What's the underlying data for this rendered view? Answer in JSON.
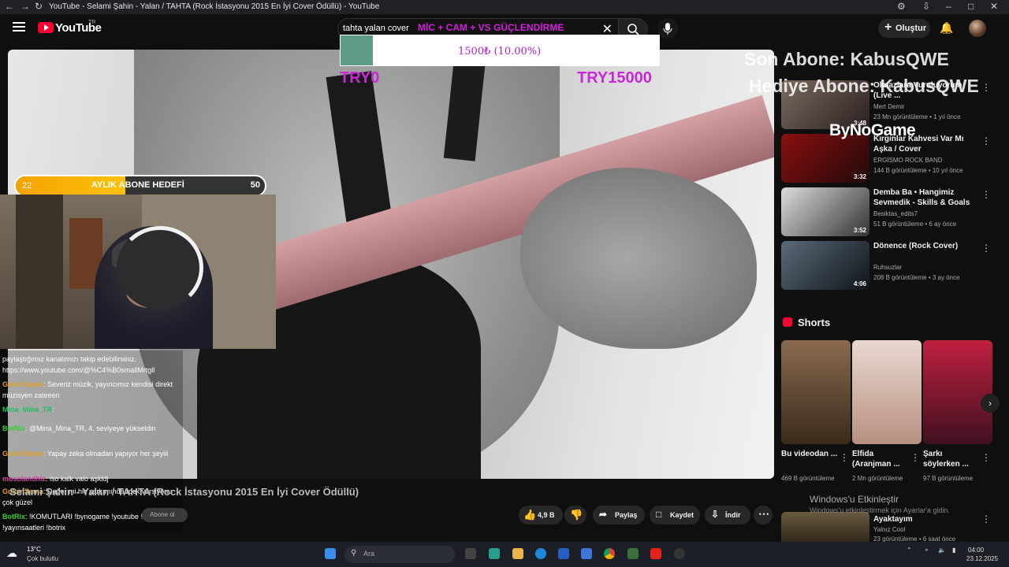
{
  "browser": {
    "tab_title": "YouTube - Selami Şahin - Yalan / TAHTA (Rock İstasyonu 2015 En İyi Cover Ödüllü) - YouTube"
  },
  "header": {
    "logo_text": "YouTube",
    "logo_region": "TR",
    "search_value": "tahta yalan cover",
    "create_label": "Oluştur"
  },
  "overlays": {
    "mic_banner": "MİC + CAM + VS GÜÇLENDİRME",
    "donation_text": "1500₺ (10.00%)",
    "donation_min": "TRY0",
    "donation_max": "TRY15000",
    "goal_current": "22",
    "goal_label": "AYLIK ABONE HEDEFİ",
    "goal_target": "50",
    "goal_progress": 0.44,
    "sub_line1": "Son Abone: KabusQWE",
    "sub_line2": "Hediye Abone: KabusQWE",
    "sponsor": "ByNoGame"
  },
  "chat": [
    {
      "name": "",
      "text": "paylaştığımız kanalımızı takip edebilirsiniz. https://www.youtube.com/@%C4%B0smallMrtgll",
      "color": "#ffffff"
    },
    {
      "name": "GulcinSama",
      "text": ": Severiz müzik, yayıncımız kendisi direkt müzisyen zateeen",
      "color": "#e0a020"
    },
    {
      "name": "Mina_Mina_TR",
      "text": ":",
      "color": "#20c060"
    },
    {
      "name": "BotRix",
      "text": ": @Mina_Mina_TR, 4. seviyeye yükseldin",
      "color": "#30d030"
    },
    {
      "name": "GulcinSama",
      "text": ": Yapay zeka olmadan yapıyor her şeyiii",
      "color": "#e0a020"
    },
    {
      "name": "mosolandhiz",
      "text": ": iso kalk valo aşkldj",
      "color": "#d040a0"
    },
    {
      "name": "GulcinSama",
      "text": ": Değer mi hiç şarkımında rock versiyonu çok güzel",
      "color": "#e0a020"
    },
    {
      "name": "BotRix",
      "text": ": !KOMUTLARI !bynogame !youtube !instagram !yayınsaatleri !botrix",
      "color": "#30d030"
    }
  ],
  "video": {
    "title": "Selami Şahin - Yalan / TAHTA (Rock İstasyonu 2015 En İyi Cover Ödüllü)",
    "likes": "4,9 B",
    "share": "Paylaş",
    "save": "Kaydet",
    "download": "İndir",
    "chat_button": "Abone ol"
  },
  "related": [
    {
      "title": "Olmazlara Vuruluyorum (Live ...",
      "channel": "Mert Demir",
      "meta": "23 Mn görüntüleme • 1 yıl önce",
      "duration": "3:48"
    },
    {
      "title": "Kırgınlar Kahvesi Var Mı Aşka / Cover",
      "channel": "ERGİSMO ROCK BAND",
      "meta": "144 B görüntüleme • 10 yıl önce",
      "duration": "3:32"
    },
    {
      "title": "Demba Ba • Hangimiz Sevmedik - Skills & Goals",
      "channel": "Besiktas_edits7",
      "meta": "51 B görüntüleme • 6 ay önce",
      "duration": "3:52"
    },
    {
      "title": "Dönence (Rock Cover)",
      "channel": "Ruhsuzlar",
      "meta": "208 B görüntüleme • 3 ay önce",
      "duration": "4:06"
    }
  ],
  "shorts": {
    "heading": "Shorts",
    "items": [
      {
        "title": "Bu videodan ...",
        "views": "469 B görüntüleme"
      },
      {
        "title": "Elfida (Aranjman ...",
        "views": "2 Mn görüntüleme"
      },
      {
        "title": "Şarkı söylerken ...",
        "views": "97 B görüntüleme"
      }
    ]
  },
  "next_video": {
    "title": "Ayaktayım",
    "channel": "Yalnız Cool",
    "meta": "23 görüntüleme • 6 saat önce"
  },
  "watermark": {
    "line1": "Windows'u Etkinleştir",
    "line2": "Windows'u etkinleştirmek için Ayarlar'a gidin."
  },
  "taskbar": {
    "weather_temp": "13°C",
    "weather_desc": "Çok bulutlu",
    "search_placeholder": "Ara",
    "time": "04:00",
    "date": "23.12.2025"
  }
}
